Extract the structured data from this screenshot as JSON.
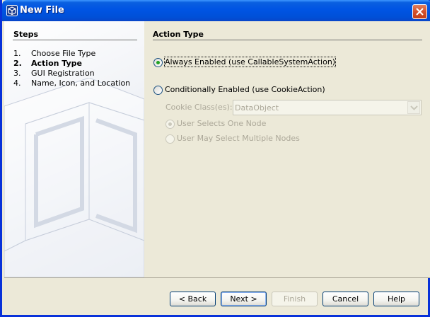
{
  "window": {
    "title": "New File"
  },
  "steps": {
    "title": "Steps",
    "items": [
      {
        "num": "1.",
        "label": "Choose File Type"
      },
      {
        "num": "2.",
        "label": "Action Type"
      },
      {
        "num": "3.",
        "label": "GUI Registration"
      },
      {
        "num": "4.",
        "label": "Name, Icon, and Location"
      }
    ],
    "current_index": 1
  },
  "action_type": {
    "title": "Action Type",
    "always_enabled_label": "Always Enabled (use CallableSystemAction)",
    "conditionally_enabled_label": "Conditionally Enabled (use CookieAction)",
    "selected": "always_enabled",
    "cookie_classes_label": "Cookie Class(es):",
    "cookie_classes_value": "DataObject",
    "one_node_label": "User Selects One Node",
    "multiple_nodes_label": "User May Select Multiple Nodes",
    "node_selection": "one_node"
  },
  "buttons": {
    "back": "< Back",
    "next": "Next >",
    "finish": "Finish",
    "cancel": "Cancel",
    "help": "Help"
  },
  "colors": {
    "titlebar": "#0054e3",
    "radio_selected": "#21a121",
    "disabled_text": "#aca899"
  }
}
